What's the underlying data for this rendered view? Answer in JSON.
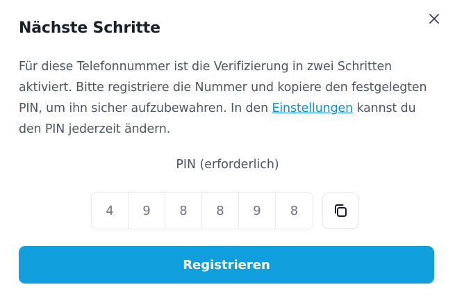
{
  "dialog": {
    "title": "Nächste Schritte",
    "close_icon": "close-icon"
  },
  "description": {
    "text_before_link": "Für diese Telefonnummer ist die Verifizierung in zwei Schritten aktiviert. Bitte registriere die Nummer und kopiere den festgelegten PIN, um ihn sicher aufzubewahren. In den ",
    "link_text": "Einstellungen",
    "text_after_link": " kannst du den PIN jederzeit ändern."
  },
  "pin": {
    "label": "PIN (erforderlich)",
    "digits": [
      "4",
      "9",
      "8",
      "8",
      "9",
      "8"
    ],
    "copy_icon": "copy-icon"
  },
  "actions": {
    "register_label": "Registrieren"
  },
  "colors": {
    "accent": "#109fdc",
    "link": "#0b8fcf",
    "title": "#17202b",
    "body_text": "#4b5563"
  }
}
